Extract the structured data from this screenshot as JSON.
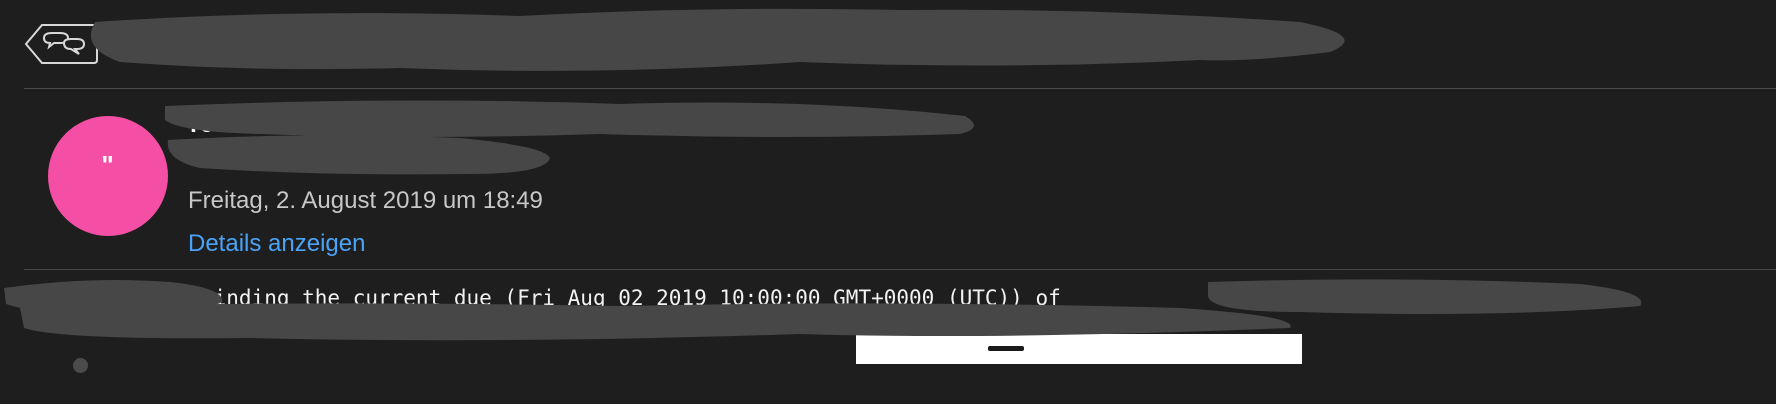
{
  "topbar": {
    "back_icon": "back-conversation-icon"
  },
  "message": {
    "avatar_initials": "\"",
    "sender": "reddit",
    "recipient": "",
    "date": "Freitag, 2. August 2019 um 18:49",
    "details_link": "Details anzeigen"
  },
  "body": {
    "line1": "        was reminding the current due (Fri Aug 02 2019 10:00:00 GMT+0000 (UTC)) of                                is now",
    "line2": ""
  },
  "colors": {
    "background": "#1e1e1e",
    "avatar": "#f54fa5",
    "link": "#4aa3f7",
    "redaction": "#474747"
  }
}
